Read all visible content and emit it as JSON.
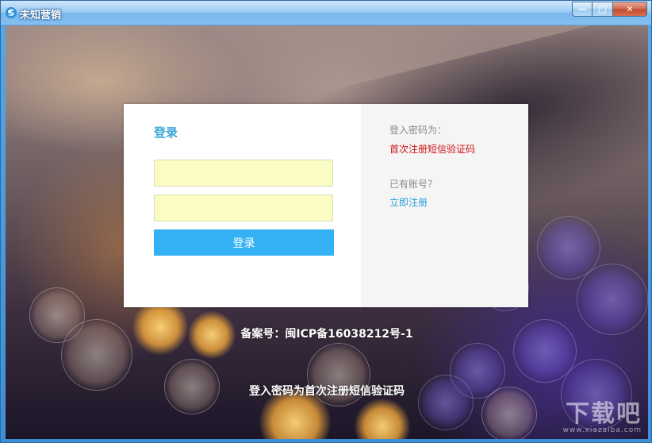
{
  "window": {
    "title": "未知营销",
    "controls": {
      "minimize": "—",
      "maximize": "□",
      "close": "✕"
    }
  },
  "login": {
    "heading": "登录",
    "username_placeholder": "",
    "password_placeholder": "",
    "submit_label": "登录"
  },
  "sidebar": {
    "password_hint_label": "登入密码为：",
    "password_hint_value": "首次注册短信验证码",
    "account_question": "已有账号？",
    "register_link": "立即注册"
  },
  "footer": {
    "icp": "备案号：闽ICP备16038212号-1",
    "notice": "登入密码为首次注册短信验证码"
  },
  "watermark": {
    "main": "下载吧",
    "sub": "www.xiazaiba.com"
  },
  "colors": {
    "accent": "#34b1f4",
    "heading": "#3aa8d8",
    "warning": "#cc1111",
    "field_bg": "#fbfcc4"
  }
}
